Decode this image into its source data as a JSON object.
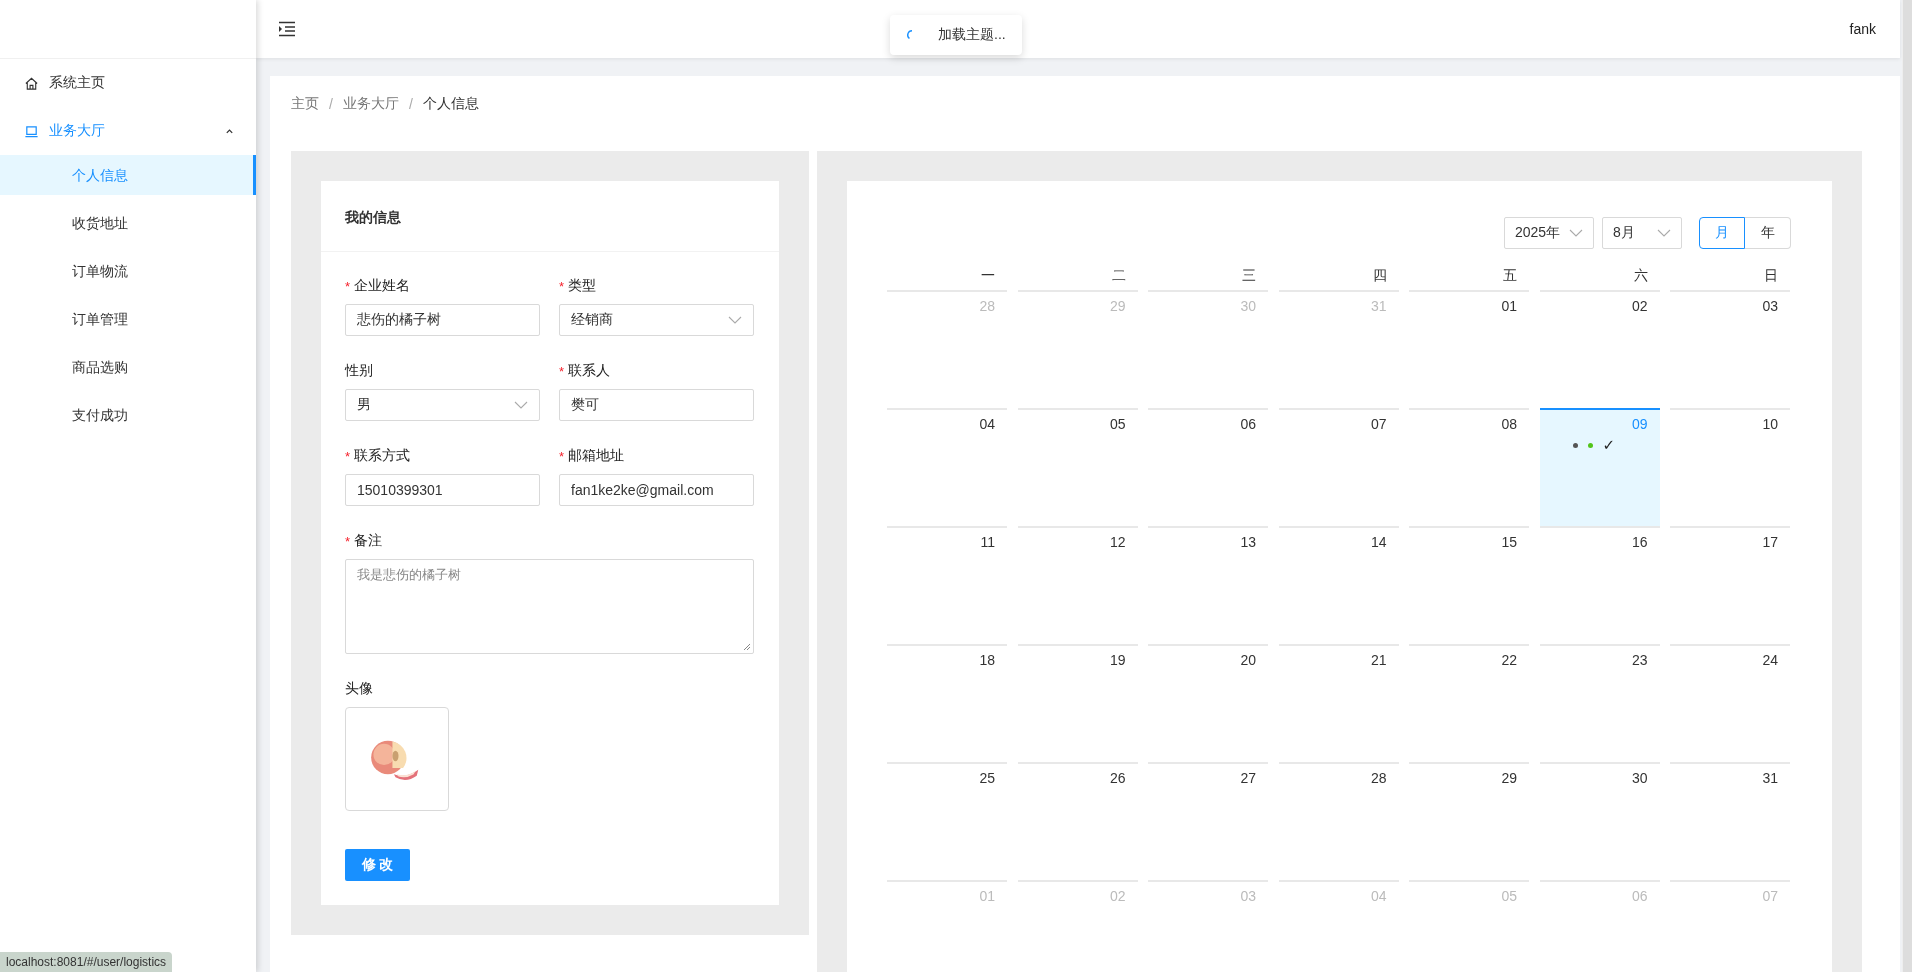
{
  "sidebar": {
    "items": [
      {
        "label": "系统主页",
        "kind": "home",
        "selected": false
      },
      {
        "label": "业务大厅",
        "kind": "laptop",
        "selected": true,
        "expanded": true,
        "children": [
          {
            "label": "个人信息",
            "selected": true
          },
          {
            "label": "收货地址",
            "selected": false
          },
          {
            "label": "订单物流",
            "selected": false
          },
          {
            "label": "订单管理",
            "selected": false
          },
          {
            "label": "商品选购",
            "selected": false
          },
          {
            "label": "支付成功",
            "selected": false
          }
        ]
      }
    ]
  },
  "header": {
    "user": "fank"
  },
  "toast": {
    "text": "加载主题..."
  },
  "breadcrumb": {
    "separator": "/",
    "items": [
      {
        "label": "主页",
        "current": false
      },
      {
        "label": "业务大厅",
        "current": false
      },
      {
        "label": "个人信息",
        "current": true
      }
    ]
  },
  "form": {
    "title": "我的信息",
    "fields": [
      {
        "label": "企业姓名",
        "required_mark": "*",
        "kind": "input",
        "value": "悲伤的橘子树"
      },
      {
        "label": "类型",
        "required_mark": "*",
        "kind": "select",
        "value": "经销商"
      },
      {
        "label": "性别",
        "kind": "select",
        "value": "男"
      },
      {
        "label": "联系人",
        "required_mark": "*",
        "kind": "input",
        "value": "樊可"
      },
      {
        "label": "联系方式",
        "required_mark": "*",
        "kind": "input",
        "value": "15010399301"
      },
      {
        "label": "邮箱地址",
        "required_mark": "*",
        "kind": "input",
        "value": "fan1ke2ke@gmail.com"
      },
      {
        "label": "备注",
        "required_mark": "*",
        "kind": "textarea",
        "placeholder": "我是悲伤的橘子树"
      },
      {
        "label": "头像",
        "kind": "avatar"
      }
    ],
    "submit": "修 改"
  },
  "calendar": {
    "year_select": "2025年",
    "month_select": "8月",
    "modes": [
      {
        "label": "月",
        "selected": true
      },
      {
        "label": "年",
        "selected": false
      }
    ],
    "weekdays": [
      "一",
      "二",
      "三",
      "四",
      "五",
      "六",
      "日"
    ],
    "weeks": [
      [
        {
          "day": "28",
          "other_month": true,
          "selected": false
        },
        {
          "day": "29",
          "other_month": true,
          "selected": false
        },
        {
          "day": "30",
          "other_month": true,
          "selected": false
        },
        {
          "day": "31",
          "other_month": true,
          "selected": false
        },
        {
          "day": "01",
          "other_month": false,
          "selected": false
        },
        {
          "day": "02",
          "other_month": false,
          "selected": false
        },
        {
          "day": "03",
          "other_month": false,
          "selected": false
        }
      ],
      [
        {
          "day": "04",
          "other_month": false,
          "selected": false
        },
        {
          "day": "05",
          "other_month": false,
          "selected": false
        },
        {
          "day": "06",
          "other_month": false,
          "selected": false
        },
        {
          "day": "07",
          "other_month": false,
          "selected": false
        },
        {
          "day": "08",
          "other_month": false,
          "selected": false
        },
        {
          "day": "09",
          "other_month": false,
          "selected": true,
          "events": [
            {
              "kind": "dot",
              "color": "#555555"
            },
            {
              "kind": "dot",
              "color": "#52c41a"
            },
            {
              "kind": "check",
              "text": "✓"
            }
          ]
        },
        {
          "day": "10",
          "other_month": false,
          "selected": false
        }
      ],
      [
        {
          "day": "11",
          "other_month": false,
          "selected": false
        },
        {
          "day": "12",
          "other_month": false,
          "selected": false
        },
        {
          "day": "13",
          "other_month": false,
          "selected": false
        },
        {
          "day": "14",
          "other_month": false,
          "selected": false
        },
        {
          "day": "15",
          "other_month": false,
          "selected": false
        },
        {
          "day": "16",
          "other_month": false,
          "selected": false
        },
        {
          "day": "17",
          "other_month": false,
          "selected": false
        }
      ],
      [
        {
          "day": "18",
          "other_month": false,
          "selected": false
        },
        {
          "day": "19",
          "other_month": false,
          "selected": false
        },
        {
          "day": "20",
          "other_month": false,
          "selected": false
        },
        {
          "day": "21",
          "other_month": false,
          "selected": false
        },
        {
          "day": "22",
          "other_month": false,
          "selected": false
        },
        {
          "day": "23",
          "other_month": false,
          "selected": false
        },
        {
          "day": "24",
          "other_month": false,
          "selected": false
        }
      ],
      [
        {
          "day": "25",
          "other_month": false,
          "selected": false
        },
        {
          "day": "26",
          "other_month": false,
          "selected": false
        },
        {
          "day": "27",
          "other_month": false,
          "selected": false
        },
        {
          "day": "28",
          "other_month": false,
          "selected": false
        },
        {
          "day": "29",
          "other_month": false,
          "selected": false
        },
        {
          "day": "30",
          "other_month": false,
          "selected": false
        },
        {
          "day": "31",
          "other_month": false,
          "selected": false
        }
      ],
      [
        {
          "day": "01",
          "other_month": true,
          "selected": false
        },
        {
          "day": "02",
          "other_month": true,
          "selected": false
        },
        {
          "day": "03",
          "other_month": true,
          "selected": false
        },
        {
          "day": "04",
          "other_month": true,
          "selected": false
        },
        {
          "day": "05",
          "other_month": true,
          "selected": false
        },
        {
          "day": "06",
          "other_month": true,
          "selected": false
        },
        {
          "day": "07",
          "other_month": true,
          "selected": false
        }
      ]
    ]
  },
  "status_bar": {
    "url": "localhost:8081/#/user/logistics"
  }
}
